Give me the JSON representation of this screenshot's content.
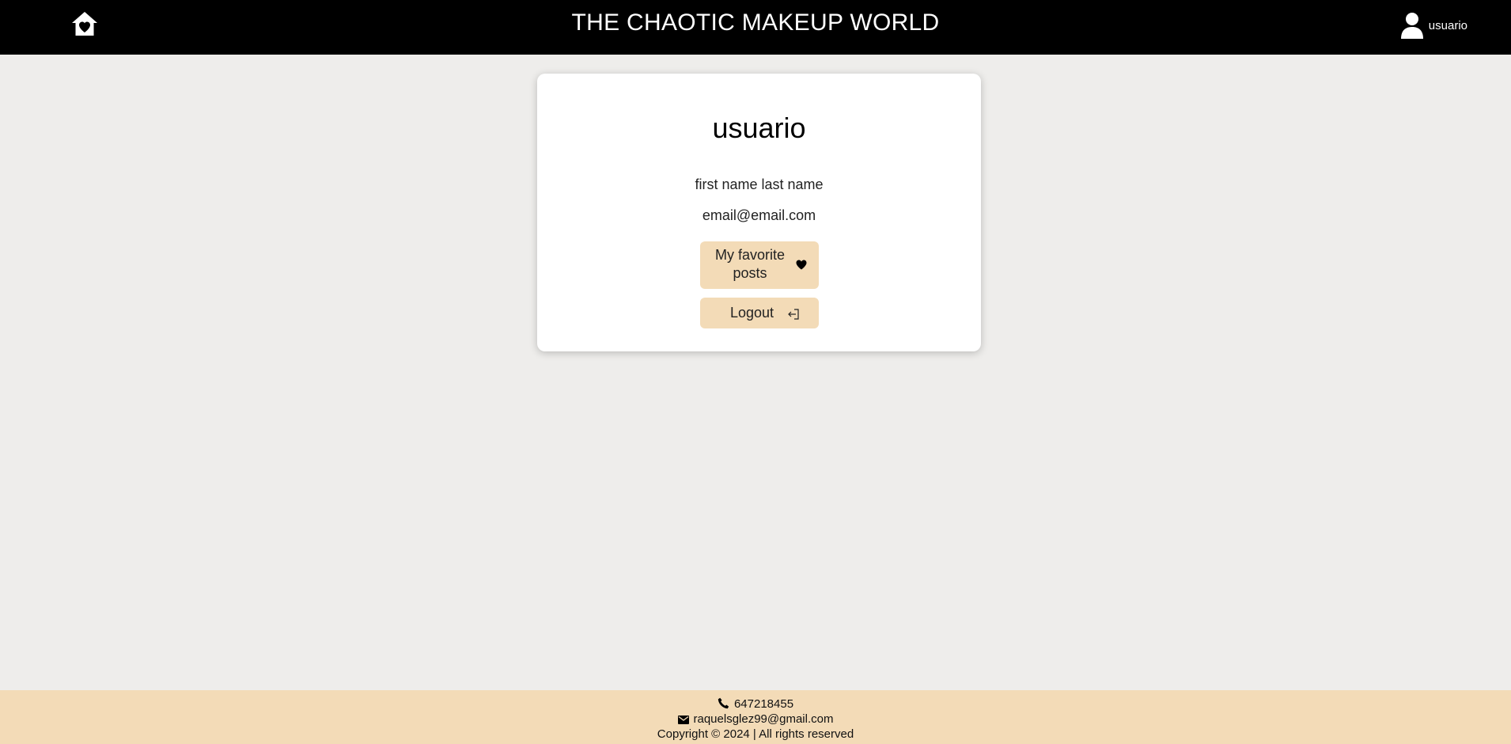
{
  "header": {
    "title": "THE CHAOTIC MAKEUP WORLD",
    "user_name": "usuario",
    "home_icon": "home-heart-icon",
    "user_icon": "user-icon"
  },
  "profile": {
    "username": "usuario",
    "full_name": "first name last name",
    "email": "email@email.com",
    "favorites_button": "My favorite posts",
    "favorites_icon": "heart-icon",
    "logout_button": "Logout",
    "logout_icon": "logout-icon"
  },
  "footer": {
    "phone": "647218455",
    "email": "raquelsglez99@gmail.com",
    "copyright": "Copyright © 2024 | All rights reserved",
    "phone_icon": "phone-icon",
    "mail_icon": "mail-icon"
  },
  "colors": {
    "header_bg": "#000000",
    "page_bg": "#eeedeb",
    "accent": "#f3dbb7",
    "card_bg": "#ffffff"
  }
}
